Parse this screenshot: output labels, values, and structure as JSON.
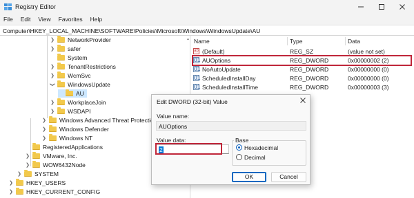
{
  "window": {
    "title": "Registry Editor"
  },
  "menu": [
    "File",
    "Edit",
    "View",
    "Favorites",
    "Help"
  ],
  "address": "Computer\\HKEY_LOCAL_MACHINE\\SOFTWARE\\Policies\\Microsoft\\Windows\\WindowsUpdate\\AU",
  "tree": [
    {
      "label": "NetworkProvider",
      "expander": "chevron-right",
      "selected": false
    },
    {
      "label": "safer",
      "expander": "chevron-right",
      "selected": false
    },
    {
      "label": "System",
      "expander": "none",
      "selected": false
    },
    {
      "label": "TenantRestrictions",
      "expander": "chevron-right",
      "selected": false
    },
    {
      "label": "WcmSvc",
      "expander": "chevron-right",
      "selected": false
    },
    {
      "label": "WindowsUpdate",
      "expander": "chevron-down",
      "selected": false
    },
    {
      "label": "AU",
      "expander": "none",
      "selected": true
    },
    {
      "label": "WorkplaceJoin",
      "expander": "chevron-right",
      "selected": false
    },
    {
      "label": "WSDAPI",
      "expander": "chevron-right",
      "selected": false
    },
    {
      "label": "Windows Advanced Threat Protectio",
      "expander": "chevron-right",
      "selected": false
    },
    {
      "label": "Windows Defender",
      "expander": "chevron-right",
      "selected": false
    },
    {
      "label": "Windows NT",
      "expander": "chevron-right",
      "selected": false
    },
    {
      "label": "RegisteredApplications",
      "expander": "none",
      "selected": false
    },
    {
      "label": "VMware, Inc.",
      "expander": "chevron-right",
      "selected": false
    },
    {
      "label": "WOW6432Node",
      "expander": "chevron-right",
      "selected": false
    },
    {
      "label": "SYSTEM",
      "expander": "chevron-right",
      "selected": false
    },
    {
      "label": "HKEY_USERS",
      "expander": "chevron-right",
      "selected": false
    },
    {
      "label": "HKEY_CURRENT_CONFIG",
      "expander": "chevron-right",
      "selected": false
    }
  ],
  "columns": {
    "name": "Name",
    "type": "Type",
    "data": "Data"
  },
  "values": [
    {
      "name": "(Default)",
      "type": "REG_SZ",
      "data": "(value not set)",
      "icon": "string-value-icon"
    },
    {
      "name": "AUOptions",
      "type": "REG_DWORD",
      "data": "0x00000002 (2)",
      "icon": "dword-value-icon"
    },
    {
      "name": "NoAutoUpdate",
      "type": "REG_DWORD",
      "data": "0x00000000 (0)",
      "icon": "dword-value-icon"
    },
    {
      "name": "ScheduledInstallDay",
      "type": "REG_DWORD",
      "data": "0x00000000 (0)",
      "icon": "dword-value-icon"
    },
    {
      "name": "ScheduledInstallTime",
      "type": "REG_DWORD",
      "data": "0x00000003 (3)",
      "icon": "dword-value-icon"
    }
  ],
  "dialog": {
    "title": "Edit DWORD (32-bit) Value",
    "value_name_label": "Value name:",
    "value_name": "AUOptions",
    "value_data_label": "Value data:",
    "value_data": "2",
    "base_label": "Base",
    "base_options": [
      "Hexadecimal",
      "Decimal"
    ],
    "base_selected": "Hexadecimal",
    "ok_label": "OK",
    "cancel_label": "Cancel"
  },
  "colors": {
    "highlight_outline": "#c0263a",
    "tree_selection": "#cde8ff",
    "accent": "#0067c0"
  }
}
